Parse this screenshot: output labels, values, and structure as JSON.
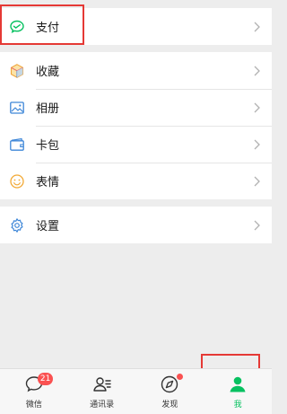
{
  "menu": {
    "pay": {
      "label": "支付",
      "icon": "pay-check-icon"
    },
    "favorites": {
      "label": "收藏",
      "icon": "cube-icon"
    },
    "album": {
      "label": "相册",
      "icon": "picture-icon"
    },
    "cards": {
      "label": "卡包",
      "icon": "card-wallet-icon"
    },
    "stickers": {
      "label": "表情",
      "icon": "smiley-icon"
    },
    "settings": {
      "label": "设置",
      "icon": "gear-icon"
    }
  },
  "tabbar": {
    "tabs": [
      {
        "label": "微信",
        "icon": "chat-bubble-icon",
        "badge": "21"
      },
      {
        "label": "通讯录",
        "icon": "contacts-icon"
      },
      {
        "label": "发现",
        "icon": "compass-icon",
        "dot": true
      },
      {
        "label": "我",
        "icon": "person-icon",
        "active": true
      }
    ]
  },
  "colors": {
    "accent": "#07c160",
    "badge": "#fa5151",
    "highlight": "#e53935"
  }
}
